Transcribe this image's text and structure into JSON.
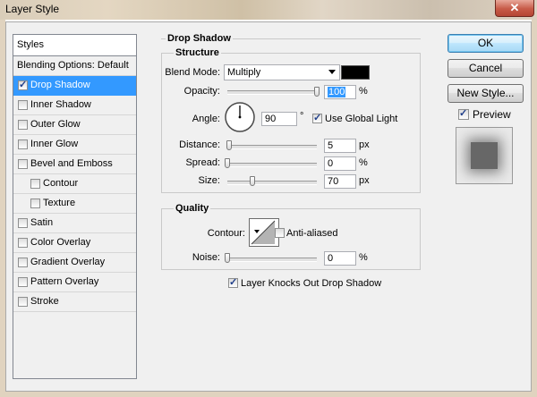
{
  "window": {
    "title": "Layer Style",
    "close_glyph": "✕"
  },
  "styles_panel": {
    "header": "Styles",
    "items": [
      {
        "label": "Blending Options: Default",
        "checkbox": false,
        "checked": false,
        "indent": false,
        "selected": false
      },
      {
        "label": "Drop Shadow",
        "checkbox": true,
        "checked": true,
        "indent": false,
        "selected": true
      },
      {
        "label": "Inner Shadow",
        "checkbox": true,
        "checked": false,
        "indent": false,
        "selected": false
      },
      {
        "label": "Outer Glow",
        "checkbox": true,
        "checked": false,
        "indent": false,
        "selected": false
      },
      {
        "label": "Inner Glow",
        "checkbox": true,
        "checked": false,
        "indent": false,
        "selected": false
      },
      {
        "label": "Bevel and Emboss",
        "checkbox": true,
        "checked": false,
        "indent": false,
        "selected": false
      },
      {
        "label": "Contour",
        "checkbox": true,
        "checked": false,
        "indent": true,
        "selected": false
      },
      {
        "label": "Texture",
        "checkbox": true,
        "checked": false,
        "indent": true,
        "selected": false
      },
      {
        "label": "Satin",
        "checkbox": true,
        "checked": false,
        "indent": false,
        "selected": false
      },
      {
        "label": "Color Overlay",
        "checkbox": true,
        "checked": false,
        "indent": false,
        "selected": false
      },
      {
        "label": "Gradient Overlay",
        "checkbox": true,
        "checked": false,
        "indent": false,
        "selected": false
      },
      {
        "label": "Pattern Overlay",
        "checkbox": true,
        "checked": false,
        "indent": false,
        "selected": false
      },
      {
        "label": "Stroke",
        "checkbox": true,
        "checked": false,
        "indent": false,
        "selected": false
      }
    ]
  },
  "drop_shadow": {
    "title": "Drop Shadow",
    "structure": {
      "title": "Structure",
      "blend_mode_label": "Blend Mode:",
      "blend_mode_value": "Multiply",
      "shadow_color": "#000000",
      "opacity_label": "Opacity:",
      "opacity_value": "100",
      "opacity_unit": "%",
      "opacity_fraction": 1.0,
      "angle_label": "Angle:",
      "angle_value": "90",
      "angle_unit": "°",
      "use_global_light_label": "Use Global Light",
      "use_global_light": true,
      "distance_label": "Distance:",
      "distance_value": "5",
      "distance_unit": "px",
      "distance_fraction": 0.02,
      "spread_label": "Spread:",
      "spread_value": "0",
      "spread_unit": "%",
      "spread_fraction": 0.0,
      "size_label": "Size:",
      "size_value": "70",
      "size_unit": "px",
      "size_fraction": 0.28
    },
    "quality": {
      "title": "Quality",
      "contour_label": "Contour:",
      "anti_aliased_label": "Anti-aliased",
      "anti_aliased": false,
      "noise_label": "Noise:",
      "noise_value": "0",
      "noise_unit": "%",
      "noise_fraction": 0.0
    },
    "knocks_out_label": "Layer Knocks Out Drop Shadow",
    "knocks_out": true
  },
  "buttons": {
    "ok": "OK",
    "cancel": "Cancel",
    "new_style": "New Style..."
  },
  "preview": {
    "label": "Preview",
    "checked": true
  }
}
